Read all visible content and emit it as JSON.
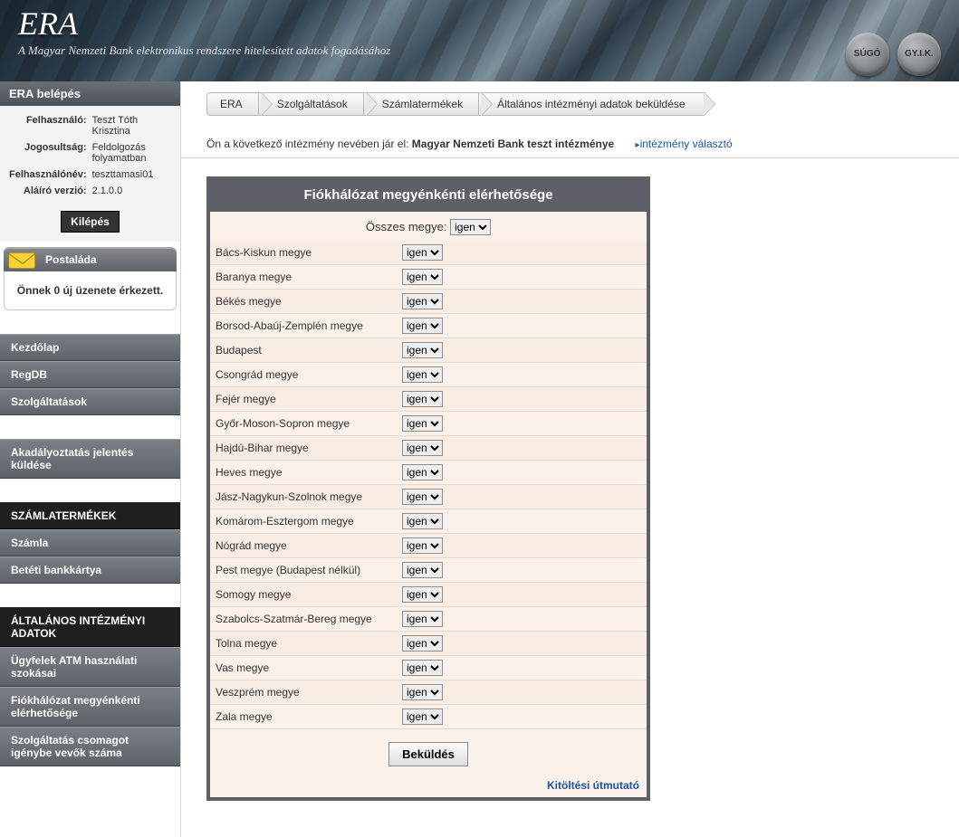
{
  "banner": {
    "title": "ERA",
    "subtitle": "A Magyar Nemzeti Bank elektronikus rendszere hitelesített adatok fogadásához"
  },
  "roundButtons": {
    "help": "SÚGÓ",
    "faq": "GY.I.K."
  },
  "login": {
    "heading": "ERA belépés",
    "userLabel": "Felhasználó:",
    "userValue": "Teszt Tóth Krisztina",
    "roleLabel": "Jogosultság:",
    "roleValue": "Feldolgozás folyamatban",
    "usernameLabel": "Felhasználónév:",
    "usernameValue": "teszttamasi01",
    "versionLabel": "Aláíró verzió:",
    "versionValue": "2.1.0.0",
    "logout": "Kilépés"
  },
  "mailbox": {
    "heading": "Postaláda",
    "body": "Önnek 0 új üzenete érkezett."
  },
  "nav": {
    "primary": [
      "Kezdőlap",
      "RegDB",
      "Szolgáltatások"
    ],
    "secondary": [
      "Akadályoztatás jelentés küldése"
    ],
    "group1Head": "SZÁMLATERMÉKEK",
    "group1": [
      "Számla",
      "Betéti bankkártya"
    ],
    "group2Head": "ÁLTALÁNOS INTÉZMÉNYI ADATOK",
    "group2": [
      "Ügyfelek ATM használati szokásai",
      "Fiókhálózat megyénkénti elérhetősége",
      "Szolgáltatás csomagot igénybe vevők száma"
    ]
  },
  "crumbs": [
    "ERA",
    "Szolgáltatások",
    "Számlatermékek",
    "Általános intézményi adatok beküldése"
  ],
  "institution": {
    "prefix": "Ön a következő intézmény nevében jár el: ",
    "name": "Magyar Nemzeti Bank teszt intézménye",
    "switch": "intézmény választó"
  },
  "form": {
    "heading": "Fiókhálózat megyénkénti elérhetősége",
    "allLabel": "Összes megye:",
    "optYes": "igen",
    "counties": [
      "Bács-Kiskun megye",
      "Baranya megye",
      "Békés megye",
      "Borsod-Abaúj-Zemplén megye",
      "Budapest",
      "Csongrád megye",
      "Fejér megye",
      "Győr-Moson-Sopron megye",
      "Hajdú-Bihar megye",
      "Heves megye",
      "Jász-Nagykun-Szolnok megye",
      "Komárom-Esztergom megye",
      "Nógrád megye",
      "Pest megye (Budapest nélkül)",
      "Somogy megye",
      "Szabolcs-Szatmár-Bereg megye",
      "Tolna megye",
      "Vas megye",
      "Veszprém megye",
      "Zala megye"
    ],
    "submit": "Beküldés",
    "guide": "Kitöltési útmutató"
  }
}
